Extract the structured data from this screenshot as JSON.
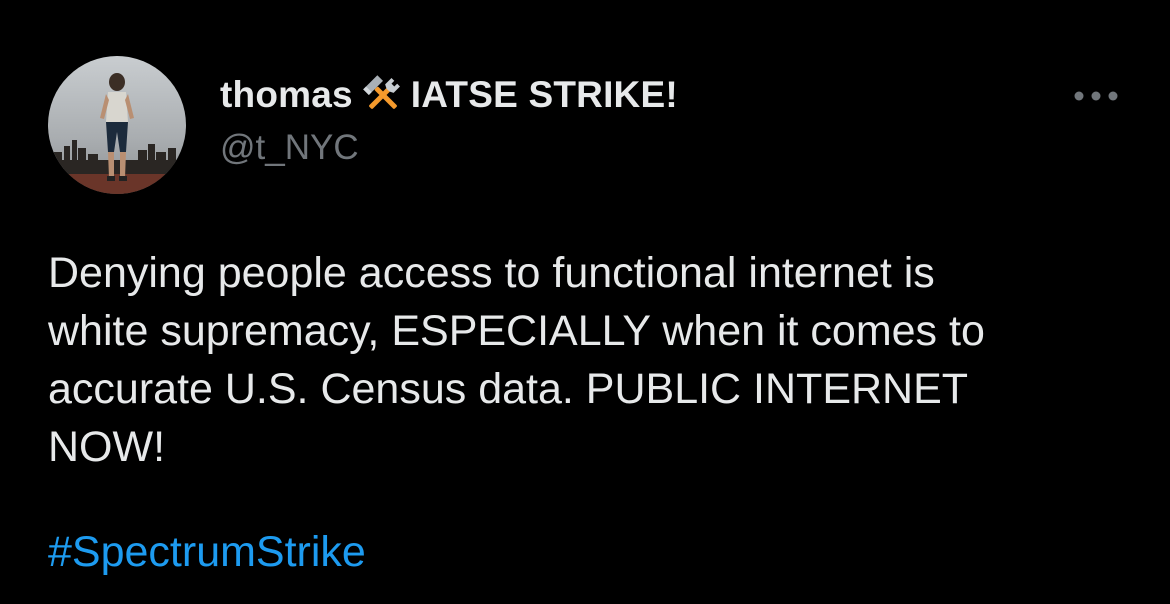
{
  "tweet": {
    "author": {
      "display_name": "thomas",
      "name_badge_icon": "hammer-and-wrench-icon",
      "name_suffix": "IATSE STRIKE!",
      "handle": "@t_NYC",
      "avatar_icon": "profile-photo-person-city-skyline"
    },
    "more_options_icon": "more-options-icon",
    "text_lines": [
      "Denying people access to functional internet is",
      "white supremacy, ESPECIALLY when it comes to",
      "accurate U.S. Census data. PUBLIC INTERNET",
      "NOW!"
    ],
    "hashtag": "#SpectrumStrike"
  },
  "colors": {
    "background": "#000000",
    "primary_text": "#e7e9ea",
    "secondary_text": "#71767b",
    "link": "#1d9bf0"
  }
}
